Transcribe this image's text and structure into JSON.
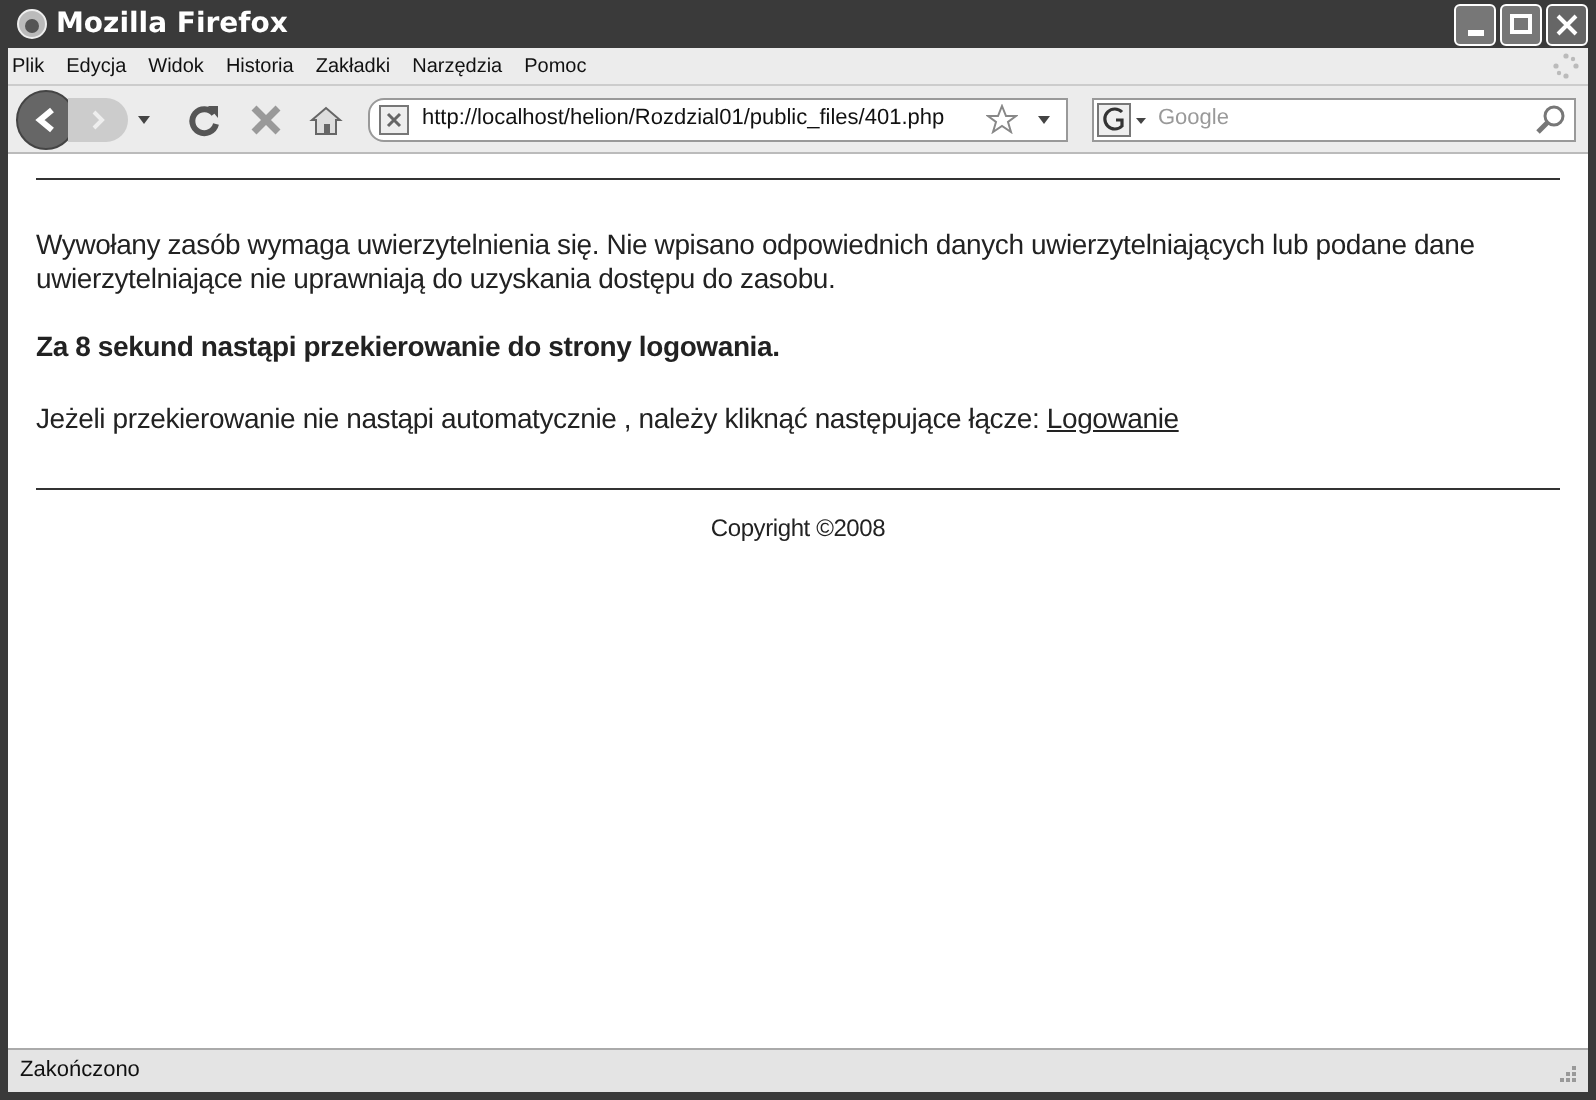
{
  "window": {
    "title": "Mozilla Firefox"
  },
  "menu": [
    "Plik",
    "Edycja",
    "Widok",
    "Historia",
    "Zakładki",
    "Narzędzia",
    "Pomoc"
  ],
  "address": {
    "value": "http://localhost/helion/Rozdzial01/public_files/401.php"
  },
  "search": {
    "placeholder": "Google"
  },
  "page": {
    "message": "Wywołany zasób wymaga uwierzytelnienia się. Nie wpisano odpowiednich danych uwierzytelniających lub podane dane uwierzytelniające nie uprawniają do uzyskania dostępu do zasobu.",
    "redirect": "Za 8 sekund nastąpi przekierowanie do strony logowania.",
    "hint": "Jeżeli przekierowanie nie nastąpi automatycznie , należy kliknąć następujące łącze:",
    "link": "Logowanie",
    "footer": "Copyright ©2008"
  },
  "status_bar": "Zakończono"
}
